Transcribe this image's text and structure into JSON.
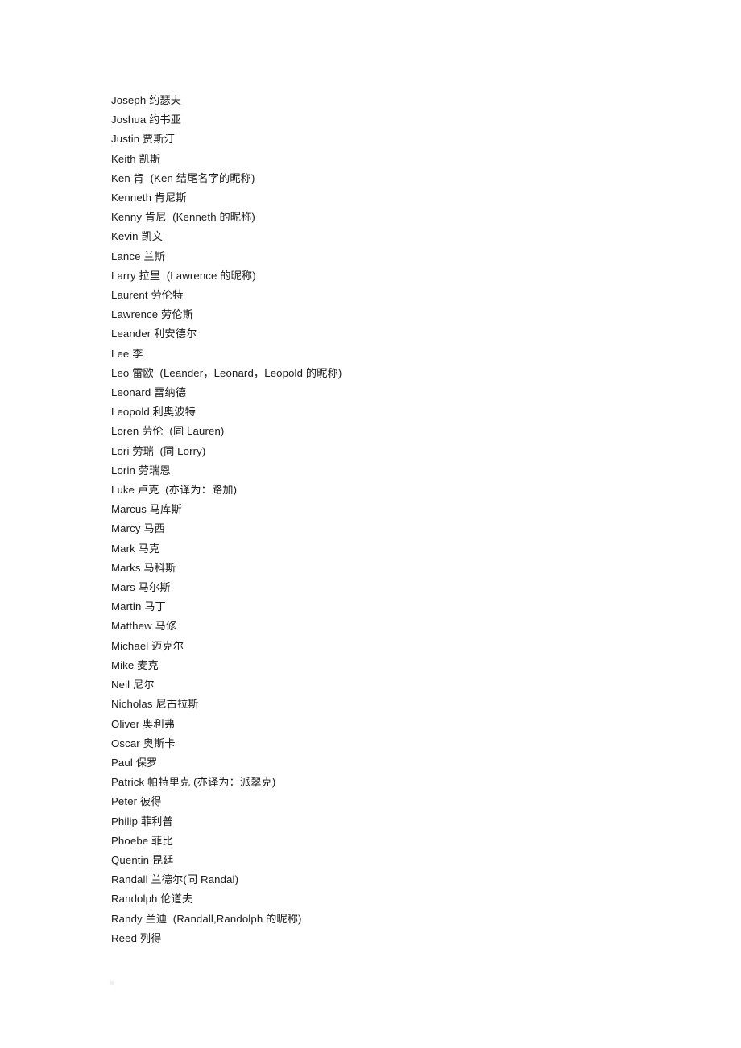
{
  "document": {
    "type": "name-glossary",
    "language": "en-zh",
    "background_color": "#ffffff",
    "text_color": "#1a1a1a",
    "entries": [
      {
        "name": "Joseph",
        "line": "Joseph 约瑟夫"
      },
      {
        "name": "Joshua",
        "line": "Joshua 约书亚"
      },
      {
        "name": "Justin",
        "line": "Justin 贾斯汀"
      },
      {
        "name": "Keith",
        "line": "Keith 凯斯"
      },
      {
        "name": "Ken",
        "line": "Ken 肯  (Ken 结尾名字的昵称)"
      },
      {
        "name": "Kenneth",
        "line": "Kenneth 肯尼斯"
      },
      {
        "name": "Kenny",
        "line": "Kenny 肯尼  (Kenneth 的昵称)"
      },
      {
        "name": "Kevin",
        "line": "Kevin 凯文"
      },
      {
        "name": "Lance",
        "line": "Lance 兰斯"
      },
      {
        "name": "Larry",
        "line": "Larry 拉里  (Lawrence 的昵称)"
      },
      {
        "name": "Laurent",
        "line": "Laurent 劳伦特"
      },
      {
        "name": "Lawrence",
        "line": "Lawrence 劳伦斯"
      },
      {
        "name": "Leander",
        "line": "Leander 利安德尔"
      },
      {
        "name": "Lee",
        "line": "Lee 李"
      },
      {
        "name": "Leo",
        "line": "Leo 雷欧  (Leander，Leonard，Leopold 的昵称)"
      },
      {
        "name": "Leonard",
        "line": "Leonard 雷纳德"
      },
      {
        "name": "Leopold",
        "line": "Leopold 利奥波特"
      },
      {
        "name": "Loren",
        "line": "Loren 劳伦  (同 Lauren)"
      },
      {
        "name": "Lori",
        "line": "Lori 劳瑞  (同 Lorry)"
      },
      {
        "name": "Lorin",
        "line": "Lorin 劳瑞恩"
      },
      {
        "name": "Luke",
        "line": "Luke 卢克  (亦译为：路加)"
      },
      {
        "name": "Marcus",
        "line": "Marcus 马库斯"
      },
      {
        "name": "Marcy",
        "line": "Marcy 马西"
      },
      {
        "name": "Mark",
        "line": "Mark 马克"
      },
      {
        "name": "Marks",
        "line": "Marks 马科斯"
      },
      {
        "name": "Mars",
        "line": "Mars 马尔斯"
      },
      {
        "name": "Martin",
        "line": "Martin 马丁"
      },
      {
        "name": "Matthew",
        "line": "Matthew 马修"
      },
      {
        "name": "Michael",
        "line": "Michael 迈克尔"
      },
      {
        "name": "Mike",
        "line": "Mike 麦克"
      },
      {
        "name": "Neil",
        "line": "Neil 尼尔"
      },
      {
        "name": "Nicholas",
        "line": "Nicholas 尼古拉斯"
      },
      {
        "name": "Oliver",
        "line": "Oliver 奥利弗"
      },
      {
        "name": "Oscar",
        "line": "Oscar 奥斯卡"
      },
      {
        "name": "Paul",
        "line": "Paul 保罗"
      },
      {
        "name": "Patrick",
        "line": "Patrick 帕特里克 (亦译为：派翠克)"
      },
      {
        "name": "Peter",
        "line": "Peter 彼得"
      },
      {
        "name": "Philip",
        "line": "Philip 菲利普"
      },
      {
        "name": "Phoebe",
        "line": "Phoebe 菲比"
      },
      {
        "name": "Quentin",
        "line": "Quentin 昆廷"
      },
      {
        "name": "Randall",
        "line": "Randall 兰德尔(同 Randal)"
      },
      {
        "name": "Randolph",
        "line": "Randolph 伦道夫"
      },
      {
        "name": "Randy",
        "line": "Randy 兰迪  (Randall,Randolph 的昵称)"
      },
      {
        "name": "Reed",
        "line": "Reed 列得"
      }
    ]
  }
}
